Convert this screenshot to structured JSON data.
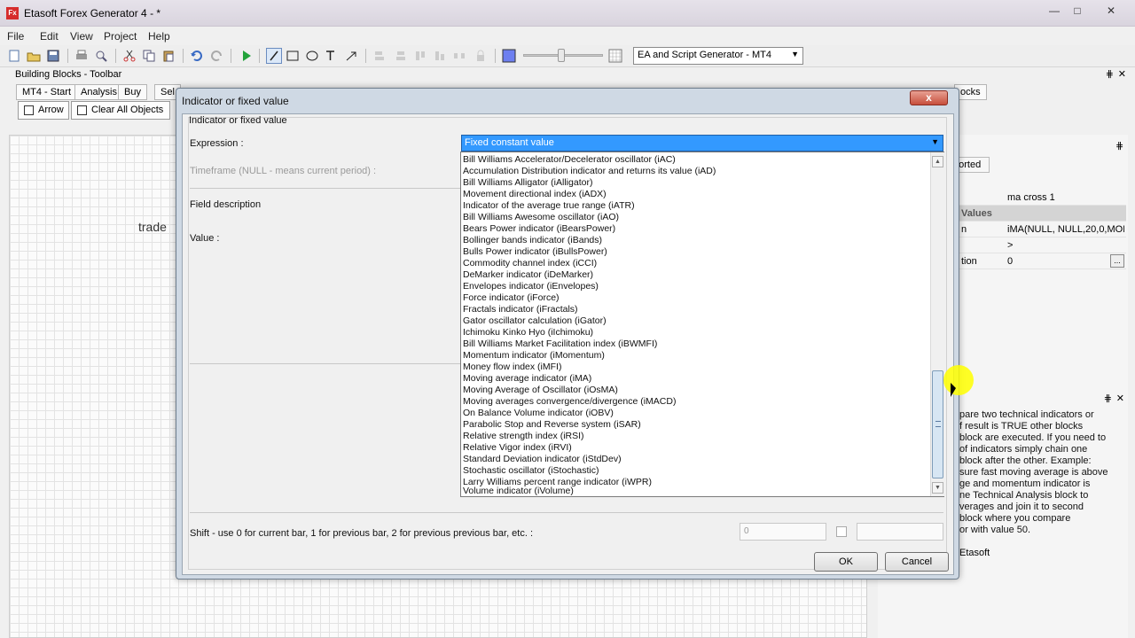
{
  "window": {
    "title": "Etasoft Forex Generator 4 - *",
    "app_icon": "Fx"
  },
  "menu": [
    "File",
    "Edit",
    "View",
    "Project",
    "Help"
  ],
  "toolbar": {
    "generator_select": "EA and Script Generator - MT4"
  },
  "building_blocks": {
    "panel_title": "Building Blocks - Toolbar",
    "tabs": [
      "MT4 - Start",
      "Analysis",
      "Buy",
      "Sel"
    ],
    "arrow_label": "Arrow",
    "clear_label": "Clear All Objects",
    "blocks_tab_tail": "ocks"
  },
  "canvas": {
    "label": "trade"
  },
  "properties": {
    "tab_label": "ported",
    "rows": [
      {
        "key": "",
        "value": "ma cross 1"
      },
      {
        "key": "Values",
        "value": ""
      },
      {
        "key": "n",
        "value": "iMA(NULL, NULL,20,0,MODE"
      },
      {
        "key": "",
        "value": ">"
      },
      {
        "key": "tion",
        "value": "0"
      }
    ]
  },
  "help": {
    "text": "pare two technical indicators or\nf result is TRUE other blocks\nblock are executed. If you need to\nof indicators simply chain one\nblock after the other. Example:\nsure fast moving average is above\nge and momentum indicator is\nne Technical Analysis block to\nverages and join it to second\nblock where you compare\nor with value 50.",
    "brand": "Etasoft"
  },
  "dialog": {
    "title": "Indicator or fixed value",
    "group_title": "Indicator or fixed value",
    "close_label": "x",
    "expression_label": "Expression :",
    "expression_value": "Fixed constant value",
    "timeframe_label": "Timeframe (NULL - means current period) :",
    "field_description_label": "Field description",
    "value_label": "Value :",
    "shift_label": "Shift - use 0 for current bar, 1 for previous bar, 2 for previous previous bar, etc. :",
    "shift_value": "0",
    "ok_label": "OK",
    "cancel_label": "Cancel",
    "options": [
      "Bill Williams Accelerator/Decelerator oscillator (iAC)",
      "Accumulation Distribution indicator and returns its value (iAD)",
      "Bill Williams Alligator (iAlligator)",
      "Movement directional index (iADX)",
      "Indicator of the average true range (iATR)",
      "Bill Williams Awesome oscillator (iAO)",
      "Bears Power indicator (iBearsPower)",
      "Bollinger bands indicator (iBands)",
      "Bulls Power indicator (iBullsPower)",
      "Commodity channel index (iCCI)",
      "DeMarker indicator (iDeMarker)",
      "Envelopes indicator (iEnvelopes)",
      "Force indicator (iForce)",
      "Fractals indicator (iFractals)",
      "Gator oscillator calculation (iGator)",
      "Ichimoku Kinko Hyo (iIchimoku)",
      "Bill Williams Market Facilitation index (iBWMFI)",
      "Momentum indicator (iMomentum)",
      "Money flow index (iMFI)",
      "Moving average indicator (iMA)",
      "Moving Average of Oscillator (iOsMA)",
      "Moving averages convergence/divergence (iMACD)",
      "On Balance Volume indicator (iOBV)",
      "Parabolic Stop and Reverse system (iSAR)",
      "Relative strength index (iRSI)",
      "Relative Vigor index (iRVI)",
      "Standard Deviation indicator (iStdDev)",
      "Stochastic oscillator (iStochastic)",
      "Larry Williams percent range indicator (iWPR)",
      "Volume indicator (iVolume)"
    ]
  }
}
